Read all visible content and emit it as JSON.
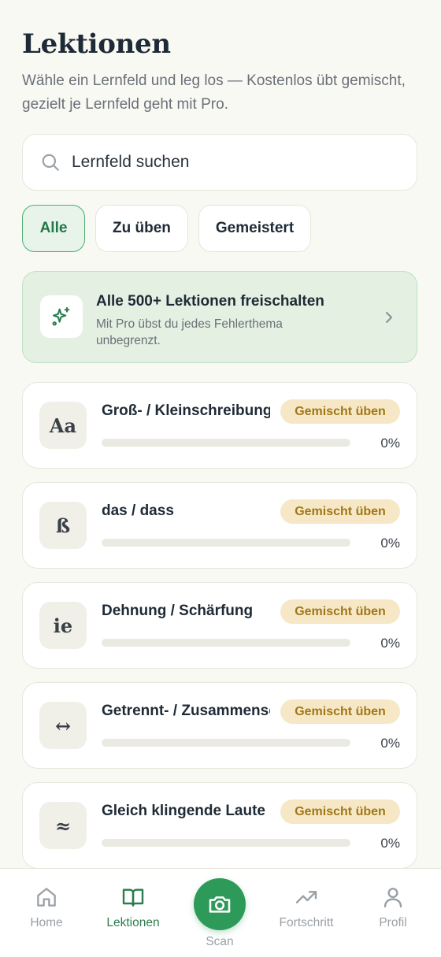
{
  "header": {
    "title": "Lektionen",
    "subtitle": "Wähle ein Lernfeld und leg los — Kostenlos übt gemischt, gezielt je Lernfeld geht mit Pro."
  },
  "search": {
    "placeholder": "Lernfeld suchen",
    "icon": "search-icon"
  },
  "filters": [
    {
      "label": "Alle",
      "active": true
    },
    {
      "label": "Zu üben",
      "active": false
    },
    {
      "label": "Gemeistert",
      "active": false
    }
  ],
  "promo": {
    "title": "Alle 500+ Lektionen freischalten",
    "description": "Mit Pro übst du jedes Fehlerthema unbegrenzt.",
    "icon": "sparkle-icon"
  },
  "lessons": [
    {
      "icon_text": "Aa",
      "title": "Groß- / Kleinschreibung",
      "badge": "Gemischt üben",
      "progress": 0,
      "progress_label": "0%"
    },
    {
      "icon_text": "ß",
      "title": "das / dass",
      "badge": "Gemischt üben",
      "progress": 0,
      "progress_label": "0%"
    },
    {
      "icon_text": "ie",
      "title": "Dehnung / Schärfung",
      "badge": "Gemischt üben",
      "progress": 0,
      "progress_label": "0%"
    },
    {
      "icon_text": "↔",
      "title": "Getrennt- / Zusammenschreibung",
      "badge": "Gemischt üben",
      "progress": 0,
      "progress_label": "0%"
    },
    {
      "icon_text": "≈",
      "title": "Gleich klingende Laute",
      "badge": "Gemischt üben",
      "progress": 0,
      "progress_label": "0%"
    }
  ],
  "nav": {
    "home": "Home",
    "lessons": "Lektionen",
    "scan": "Scan",
    "progress": "Fortschritt",
    "profile": "Profil",
    "active": "lessons"
  },
  "colors": {
    "accent": "#2e9a5a",
    "badge_bg": "#f6e8c6",
    "badge_text": "#a27617",
    "promo_bg": "#e3f0e2"
  }
}
